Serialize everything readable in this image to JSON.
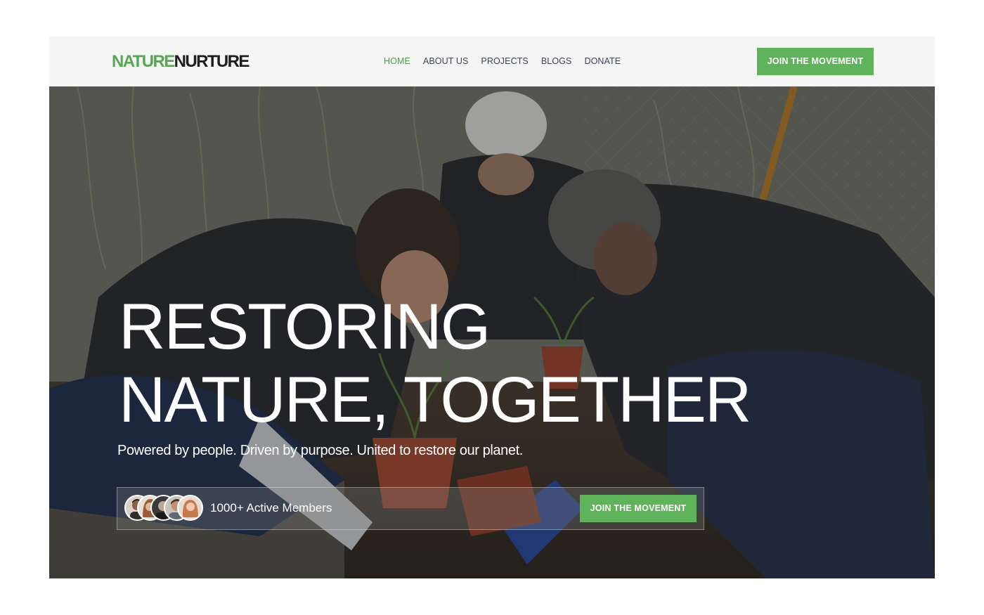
{
  "brand": {
    "logo_part1": "NATURE",
    "logo_part2": "NURTURE",
    "accent": "#5fb35a",
    "logo_green": "#5aa656"
  },
  "nav": {
    "items": [
      {
        "label": "HOME",
        "active": true
      },
      {
        "label": "ABOUT US",
        "active": false
      },
      {
        "label": "PROJECTS",
        "active": false
      },
      {
        "label": "BLOGS",
        "active": false
      },
      {
        "label": "DONATE",
        "active": false
      }
    ],
    "cta_label": "JOIN THE MOVEMENT"
  },
  "hero": {
    "headline_line1": "RESTORING",
    "headline_line2": "NATURE, TOGETHER",
    "tagline": "Powered by people. Driven by purpose. United to restore our planet.",
    "members": {
      "count_text": "1000+ Active Members",
      "cta_label": "JOIN THE MOVEMENT",
      "avatars": [
        "avatar",
        "avatar",
        "avatar",
        "avatar",
        "avatar"
      ]
    }
  }
}
